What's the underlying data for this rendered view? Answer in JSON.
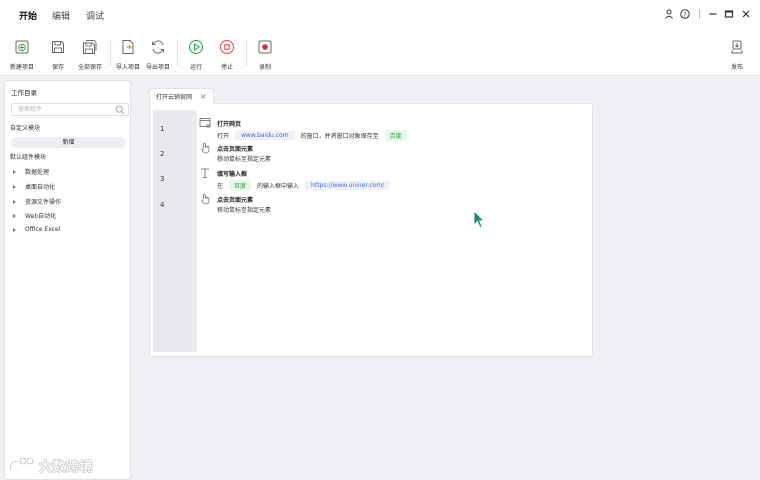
{
  "menu": {
    "tabs": [
      {
        "label": "开始",
        "active": true
      },
      {
        "label": "编辑",
        "active": false
      },
      {
        "label": "调试",
        "active": false
      }
    ]
  },
  "window_controls": [
    "user-icon",
    "help-icon",
    "minimize-icon",
    "maximize-icon",
    "close-icon"
  ],
  "toolbar": {
    "new_project": "新建项目",
    "save": "保存",
    "save_all": "全部保存",
    "import_project": "导入项目",
    "export_project": "导出项目",
    "run": "运行",
    "stop": "停止",
    "record": "录制",
    "publish": "发布"
  },
  "sidebar": {
    "title": "工作目录",
    "search_placeholder": "搜索组件",
    "custom_section": "自定义模块",
    "add_button": "新增",
    "default_section": "默认组件模块",
    "items": [
      {
        "label": "数据处理"
      },
      {
        "label": "桌面自动化"
      },
      {
        "label": "资源文件操作"
      },
      {
        "label": "Web自动化"
      },
      {
        "label": "Office Excel"
      }
    ]
  },
  "editor": {
    "tab_label": "打开云销官网",
    "line_numbers": [
      "1",
      "2",
      "3",
      "4"
    ],
    "steps": [
      {
        "title": "打开网页",
        "desc_prefix": "打开",
        "url": "www.baidu.com",
        "desc_middle": "的窗口，并将窗口对象保存至",
        "variable": "百度",
        "icon": "browser-icon"
      },
      {
        "title": "点击页面元素",
        "desc": "移动鼠标至指定元素",
        "icon": "hand-pointer-icon"
      },
      {
        "title": "填写输入框",
        "desc_prefix": "在",
        "variable": "百度",
        "desc_middle": "的输入框中输入",
        "url": "https://www.uniner.com/",
        "icon": "text-cursor-icon"
      },
      {
        "title": "点击页面元素",
        "desc": "移动鼠标至指定元素",
        "icon": "hand-pointer-icon"
      }
    ]
  },
  "watermark": {
    "text": "大数跨境"
  },
  "colors": {
    "accent_green": "#2f9b47",
    "url_blue": "#4a6fc2",
    "stop_red": "#e0433a",
    "cursor_teal": "#1f8a70"
  }
}
